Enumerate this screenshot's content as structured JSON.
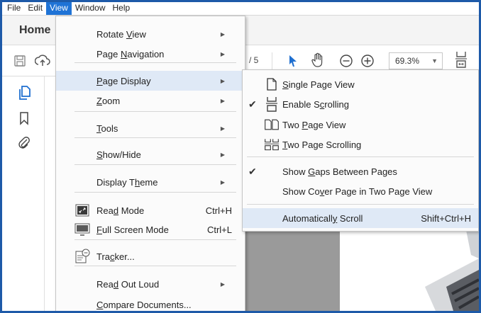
{
  "menubar": [
    "File",
    "Edit",
    "View",
    "Window",
    "Help"
  ],
  "tabs": {
    "home": "Home"
  },
  "toolbar": {
    "page_of": "/ 5",
    "zoom": "69.3%"
  },
  "view_menu": [
    {
      "label": "Rotate View",
      "u": "V",
      "submenu": true
    },
    {
      "label": "Page Navigation",
      "u": "N",
      "submenu": true
    },
    {
      "label": "Page Display",
      "u": "P",
      "submenu": true,
      "highlighted": true
    },
    {
      "label": "Zoom",
      "u": "Z",
      "submenu": true
    },
    {
      "label": "Tools",
      "u": "T",
      "submenu": true
    },
    {
      "label": "Show/Hide",
      "u": "S",
      "submenu": true
    },
    {
      "label": "Display Theme",
      "u": "h",
      "submenu": true
    },
    {
      "label": "Read Mode",
      "u": "d",
      "shortcut": "Ctrl+H",
      "icon": "read-mode-icon"
    },
    {
      "label": "Full Screen Mode",
      "u": "F",
      "shortcut": "Ctrl+L",
      "icon": "full-screen-icon"
    },
    {
      "label": "Tracker...",
      "u": "c",
      "icon": "tracker-icon"
    },
    {
      "label": "Read Out Loud",
      "u": "d",
      "submenu": true
    },
    {
      "label": "Compare Documents...",
      "u": "C"
    }
  ],
  "page_display_menu": [
    {
      "label": "Single Page View",
      "u": "S",
      "icon": "single-page-icon",
      "checked": false
    },
    {
      "label": "Enable Scrolling",
      "u": "c",
      "icon": "scrolling-icon",
      "checked": true
    },
    {
      "label": "Two Page View",
      "u": "P",
      "icon": "two-page-icon",
      "checked": false
    },
    {
      "label": "Two Page Scrolling",
      "u": "T",
      "icon": "two-page-scrolling-icon",
      "checked": false
    },
    {
      "label": "Show Gaps Between Pages",
      "u": "G",
      "checked": true
    },
    {
      "label": "Show Cover Page in Two Page View",
      "u": "v",
      "checked": false
    },
    {
      "label": "Automatically Scroll",
      "u": "y",
      "shortcut": "Shift+Ctrl+H",
      "highlighted": true
    }
  ]
}
